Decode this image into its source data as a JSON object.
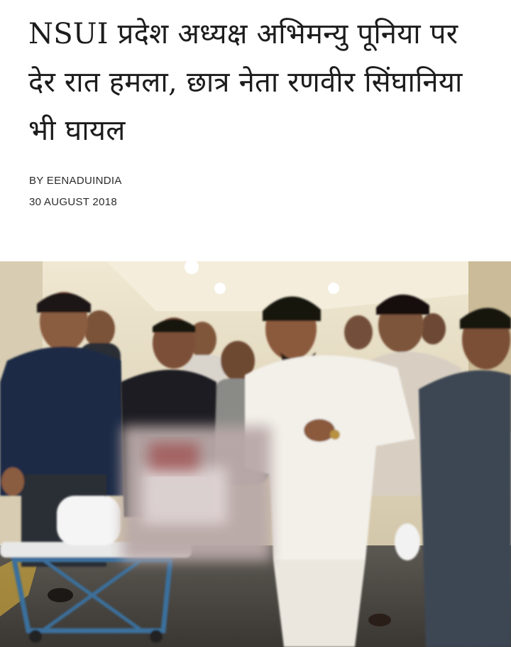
{
  "article": {
    "headline": "NSUI प्रदेश अध्यक्ष अभिमन्यु पूनिया पर देर रात हमला, छात्र नेता रणवीर सिंघानिया भी घायल",
    "byline": "BY EENADUINDIA",
    "date": "30 AUGUST 2018"
  },
  "photo": {
    "colors": {
      "wall": "#d9cdb2",
      "ceiling": "#efe6cf",
      "floor": "#4d4a45",
      "kurta": "#f2efe9",
      "dark_shirt": "#1f2a3c",
      "stretcher": "#3a6f9c",
      "blur": "#b9a9a8"
    },
    "icon": "news-photo"
  }
}
